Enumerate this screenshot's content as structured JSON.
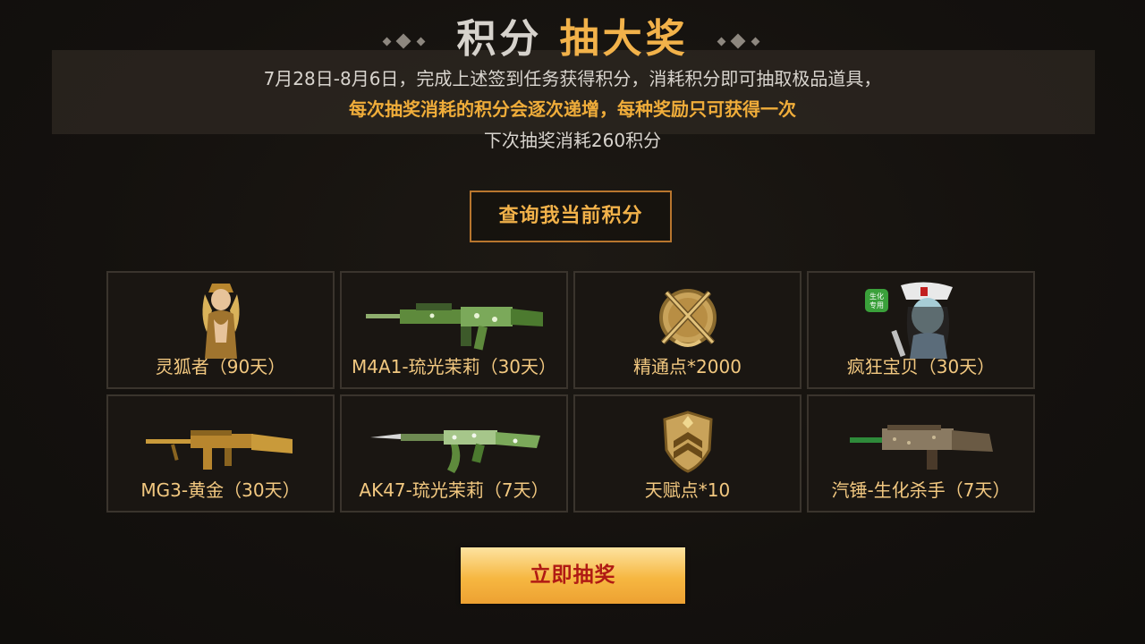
{
  "header": {
    "title_part1": "积分",
    "title_part2": "抽大奖",
    "line1": "7月28日-8月6日，完成上述签到任务获得积分，消耗积分即可抽取极品道具，",
    "line2": "每次抽奖消耗的积分会逐次递增，每种奖励只可获得一次",
    "line3": "下次抽奖消耗260积分"
  },
  "query_button": {
    "label": "查询我当前积分"
  },
  "prizes": [
    {
      "label": "灵狐者（90天）",
      "icon": "character-fox-icon"
    },
    {
      "label": "M4A1-琉光茉莉（30天）",
      "icon": "rifle-m4a1-icon"
    },
    {
      "label": "精通点*2000",
      "icon": "mastery-badge-icon"
    },
    {
      "label": "疯狂宝贝（30天）",
      "icon": "character-nurse-icon"
    },
    {
      "label": "MG3-黄金（30天）",
      "icon": "machine-gun-icon"
    },
    {
      "label": "AK47-琉光茉莉（7天）",
      "icon": "rifle-ak47-icon"
    },
    {
      "label": "天赋点*10",
      "icon": "talent-badge-icon"
    },
    {
      "label": "汽锤-生化杀手（7天）",
      "icon": "shotgun-icon"
    }
  ],
  "draw_button": {
    "label": "立即抽奖"
  },
  "colors": {
    "accent": "#f2b24a",
    "prize_text": "#f2c880",
    "draw_text": "#b01a14",
    "background": "#15120f"
  }
}
